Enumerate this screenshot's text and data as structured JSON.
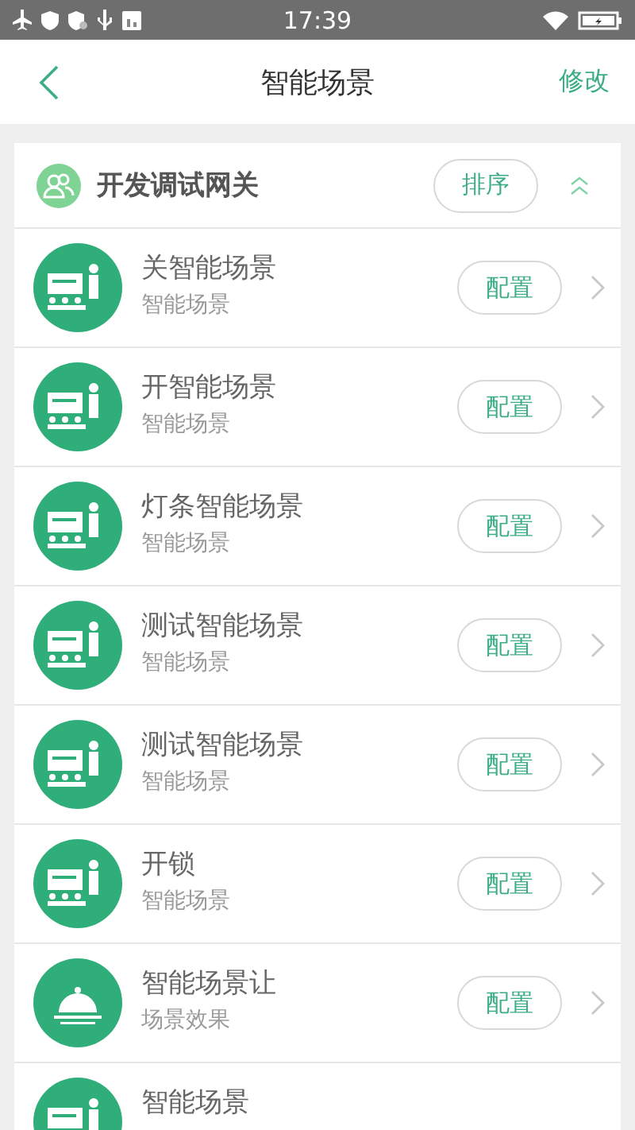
{
  "status_bar": {
    "time": "17:39"
  },
  "header": {
    "title": "智能场景",
    "action": "修改"
  },
  "group": {
    "name": "开发调试网关",
    "sort_button": "排序",
    "expanded": true
  },
  "scenes": [
    {
      "kind": "teacher",
      "title": "关智能场景",
      "subtitle": "智能场景",
      "button": "配置"
    },
    {
      "kind": "teacher",
      "title": "开智能场景",
      "subtitle": "智能场景",
      "button": "配置"
    },
    {
      "kind": "teacher",
      "title": "灯条智能场景",
      "subtitle": "智能场景",
      "button": "配置"
    },
    {
      "kind": "teacher",
      "title": "测试智能场景",
      "subtitle": "智能场景",
      "button": "配置"
    },
    {
      "kind": "teacher",
      "title": "测试智能场景",
      "subtitle": "智能场景",
      "button": "配置"
    },
    {
      "kind": "teacher",
      "title": "开锁",
      "subtitle": "智能场景",
      "button": "配置"
    },
    {
      "kind": "bell",
      "title": "智能场景让",
      "subtitle": "场景效果",
      "button": "配置"
    },
    {
      "kind": "teacher",
      "title": "智能场景"
    }
  ]
}
